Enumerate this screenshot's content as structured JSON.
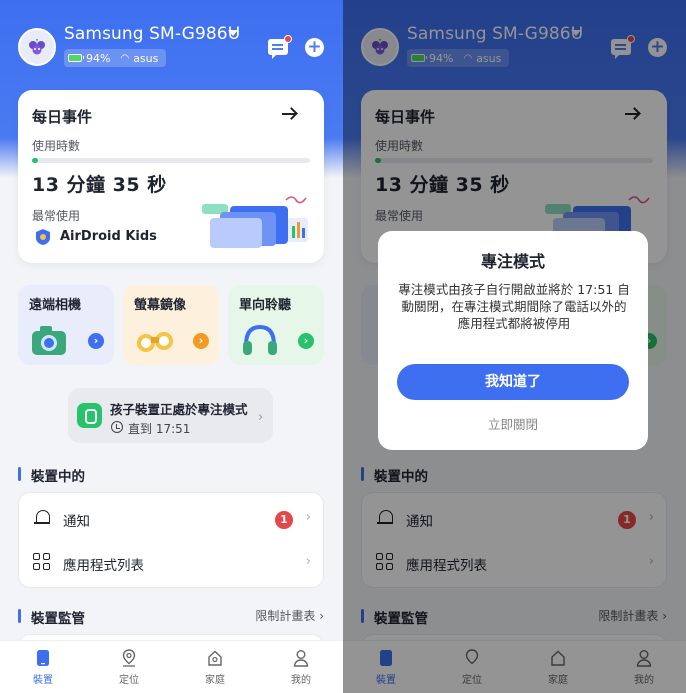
{
  "header": {
    "device_name": "Samsung SM-G986U",
    "battery": "94%",
    "wifi": "asus"
  },
  "daily": {
    "title": "每日事件",
    "usage_label": "使用時數",
    "usage_value": "13 分鐘 35 秒",
    "usage_progress_percent": 2,
    "most_used_label": "最常使用",
    "most_used_app": "AirDroid Kids"
  },
  "features": [
    {
      "label": "遠端相機",
      "bg": "#e8ecfb",
      "accent": "#3d6ff0"
    },
    {
      "label": "螢幕鏡像",
      "bg": "#fdf1de",
      "accent": "#f29b24"
    },
    {
      "label": "單向聆聽",
      "bg": "#e6f6e8",
      "accent": "#27c26c"
    }
  ],
  "focus": {
    "title": "孩子裝置正處於專注模式",
    "until": "直到 17:51"
  },
  "device_section": {
    "title": "裝置中的",
    "rows": [
      {
        "label": "通知",
        "badge": "1"
      },
      {
        "label": "應用程式列表"
      }
    ]
  },
  "monitor_section": {
    "title": "裝置監管",
    "link": "限制計畫表"
  },
  "tabs": [
    {
      "label": "裝置",
      "active": true
    },
    {
      "label": "定位"
    },
    {
      "label": "家庭"
    },
    {
      "label": "我的"
    }
  ],
  "dialog": {
    "title": "專注模式",
    "body": "專注模式由孩子自行開啟並將於 17:51 自動關閉，在專注模式期間除了電話以外的應用程式都將被停用",
    "primary": "我知道了",
    "secondary": "立即關閉"
  },
  "colors": {
    "primary": "#3d6ff0",
    "green": "#27c26c",
    "badge": "#e54848"
  }
}
